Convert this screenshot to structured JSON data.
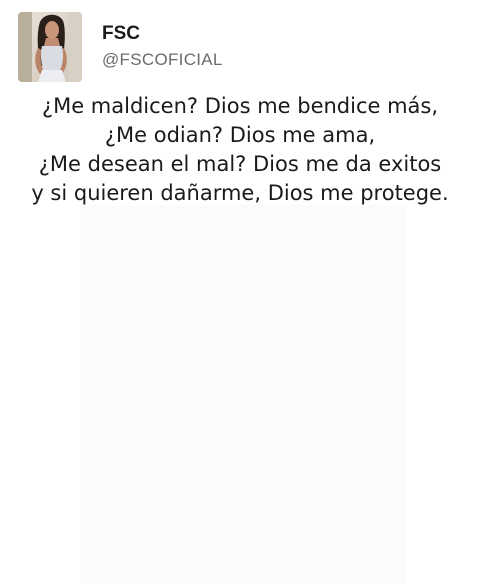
{
  "tweet": {
    "author": {
      "display_name": "FSC",
      "handle": "@FSCOFICIAL",
      "avatar_icon": "profile-photo"
    },
    "lines": [
      "¿Me maldicen? Dios me bendice más,",
      "¿Me odian? Dios me ama,",
      "¿Me desean el mal? Dios me da exitos",
      "y si quieren dañarme, Dios me protege."
    ]
  }
}
